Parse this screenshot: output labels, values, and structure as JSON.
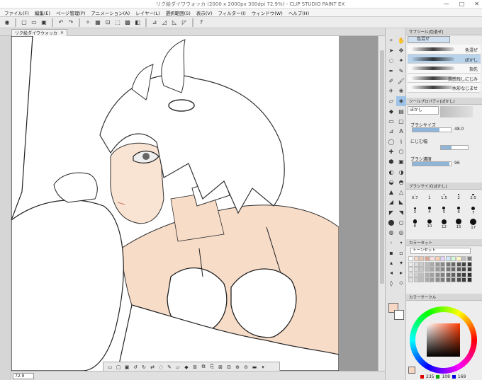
{
  "window": {
    "title": "リク絵ダイワウォッカ (2000 x 2000px 300dpi 72.9%) - CLIP STUDIO PAINT EX",
    "minimize": "—",
    "maximize": "□",
    "close": "✕"
  },
  "menu": [
    "ファイル(F)",
    "編集(E)",
    "ページ管理(P)",
    "アニメーション(A)",
    "レイヤー(L)",
    "選択範囲(S)",
    "表示(V)",
    "フィルター(I)",
    "ウィンドウ(W)",
    "ヘルプ(H)"
  ],
  "canvas_tab": {
    "label": "リク絵ダイワウォッカ",
    "close": "×"
  },
  "status": {
    "zoom": "72.9"
  },
  "subtool_panel": {
    "header": "サブツール[色混ぜ]",
    "group_tab": "色混ぜ",
    "brushes": [
      {
        "label": "色混ぜ",
        "selected": false
      },
      {
        "label": "ぼかし",
        "selected": true
      },
      {
        "label": "指先",
        "selected": false
      },
      {
        "label": "質感残しにじみ",
        "selected": false
      },
      {
        "label": "水彩なじませ",
        "selected": false
      }
    ]
  },
  "tool_property": {
    "header": "ツールプロパティ[ぼかし]",
    "name": "ぼかし",
    "brush_size_label": "ブラシサイズ",
    "brush_size_value": "48.0",
    "blur_label": "にじむ幅",
    "density_label": "ブラシ濃度",
    "density_value": "96"
  },
  "brush_size_panel": {
    "header": "ブラシサイズ[ぼかし]",
    "sizes": [
      "0.7",
      "1",
      "1.5",
      "2",
      "2.5",
      "3",
      "4",
      "5",
      "6",
      "7",
      "8",
      "10",
      "12",
      "15",
      "17"
    ]
  },
  "color_set": {
    "header": "カラーセット",
    "selected": "トーンセット"
  },
  "color_wheel": {
    "header": "カラーサークル",
    "r": "235",
    "g": "108",
    "b": "169",
    "main_color": "#f5d7c4"
  }
}
